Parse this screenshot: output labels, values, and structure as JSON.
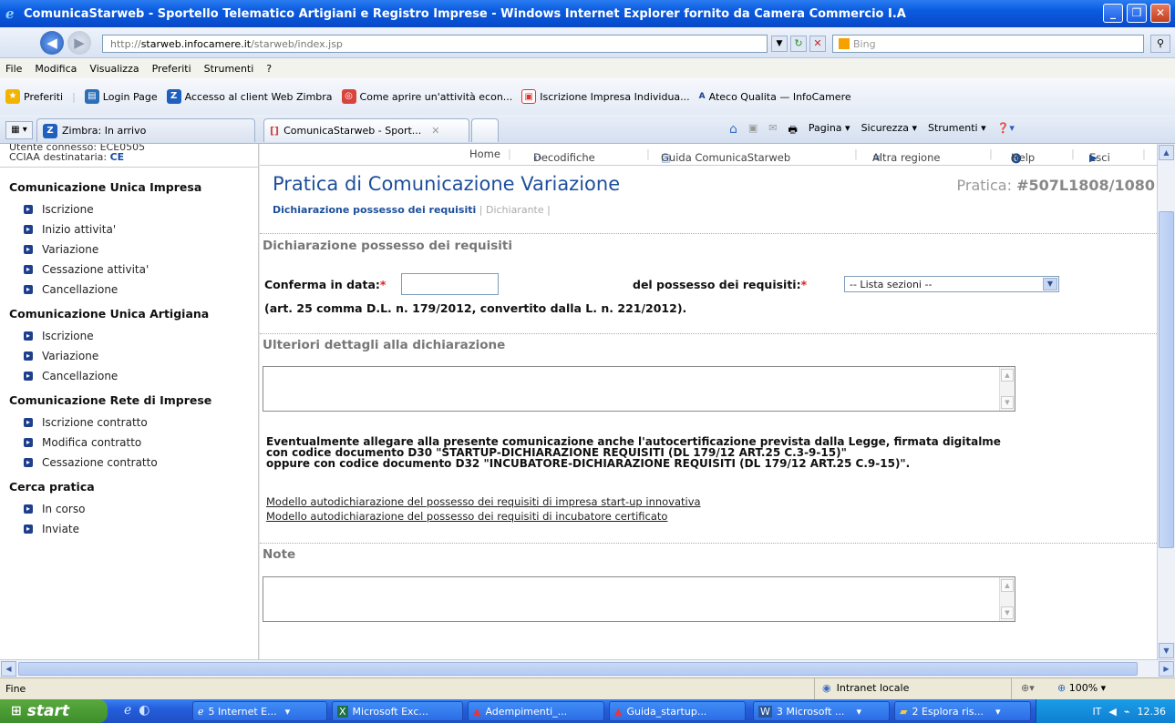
{
  "window": {
    "title": "ComunicaStarweb - Sportello Telematico Artigiani e Registro Imprese - Windows Internet Explorer fornito da Camera Commercio I.A"
  },
  "address": {
    "url_prefix": "http://",
    "url_host": "starweb.infocamere.it",
    "url_path": "/starweb/index.jsp",
    "search_placeholder": "Bing"
  },
  "menu": [
    "File",
    "Modifica",
    "Visualizza",
    "Preferiti",
    "Strumenti",
    "?"
  ],
  "favorites": {
    "label": "Preferiti",
    "items": [
      "Login Page",
      "Accesso al client Web Zimbra",
      "Come aprire un'attività econ...",
      "Iscrizione Impresa Individua...",
      "Ateco Qualita — InfoCamere"
    ]
  },
  "tabs": [
    "Zimbra: In arrivo",
    "ComunicaStarweb - Sport..."
  ],
  "commandbar": [
    "Pagina ▾",
    "Sicurezza ▾",
    "Strumenti ▾"
  ],
  "userinfo": {
    "line1": "Utente connesso: ECE0505",
    "line2_label": "CCIAA destinataria:",
    "line2_value": "CE"
  },
  "sidebar": {
    "sections": [
      {
        "title": "Comunicazione Unica Impresa",
        "items": [
          "Iscrizione",
          "Inizio attivita'",
          "Variazione",
          "Cessazione attivita'",
          "Cancellazione"
        ]
      },
      {
        "title": "Comunicazione Unica Artigiana",
        "items": [
          "Iscrizione",
          "Variazione",
          "Cancellazione"
        ]
      },
      {
        "title": "Comunicazione Rete di Imprese",
        "items": [
          "Iscrizione contratto",
          "Modifica contratto",
          "Cessazione contratto"
        ]
      },
      {
        "title": "Cerca pratica",
        "items": [
          "In corso",
          "Inviate"
        ]
      }
    ]
  },
  "topnav": {
    "home": "Home",
    "decodifiche": "Decodifiche",
    "guida": "Guida ComunicaStarweb",
    "altra_regione": "Altra regione",
    "help": "Help",
    "esci": "Esci"
  },
  "main": {
    "title": "Pratica di Comunicazione Variazione",
    "pratica_label": "Pratica:",
    "pratica_number": "#507L1808/1080",
    "subtab_active": "Dichiarazione possesso dei requisiti",
    "subtab_other": "Dichiarante",
    "section1": "Dichiarazione possesso dei requisiti",
    "conferma_label": "Conferma in data:",
    "conferma_value": "",
    "possesso_label": "del possesso dei requisiti:",
    "select_value": "-- Lista sezioni --",
    "art_text": "(art. 25 comma D.L. n. 179/2012, convertito dalla L. n. 221/2012).",
    "section2": "Ulteriori dettagli alla dichiarazione",
    "allegare_line1": "Eventualmente allegare alla presente comunicazione anche l'autocertificazione prevista dalla Legge, firmata digitalme",
    "allegare_line2": "con codice documento D30 \"STARTUP-DICHIARAZIONE REQUISITI (DL 179/12 ART.25 C.3-9-15)\"",
    "allegare_line3": "oppure con codice documento D32 \"INCUBATORE-DICHIARAZIONE REQUISITI (DL 179/12 ART.25 C.9-15)\".",
    "link1": "Modello autodichiarazione del possesso dei requisiti di impresa start-up innovativa",
    "link2": "Modello autodichiarazione del possesso dei requisiti di incubatore certificato",
    "section3": "Note"
  },
  "status": {
    "text": "Fine",
    "zone": "Intranet locale",
    "zoom": "100%"
  },
  "taskbar": {
    "start": "start",
    "tasks": [
      "5 Internet E...",
      "Microsoft Exc...",
      "Adempimenti_...",
      "Guida_startup...",
      "3 Microsoft ...",
      "2 Esplora ris..."
    ],
    "lang": "IT",
    "clock": "12.36"
  }
}
